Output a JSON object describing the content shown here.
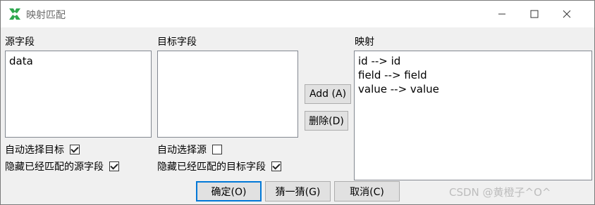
{
  "window": {
    "title": "映射匹配",
    "icon": "app-icon",
    "controls": {
      "minimize": "—",
      "maximize": "☐",
      "close": "✕"
    }
  },
  "source": {
    "label": "源字段",
    "items": [
      "data"
    ],
    "auto_select_label": "自动选择目标",
    "auto_select_checked": true,
    "hide_matched_label": "隐藏已经匹配的源字段",
    "hide_matched_checked": true
  },
  "target": {
    "label": "目标字段",
    "items": [],
    "auto_select_label": "自动选择源",
    "auto_select_checked": false,
    "hide_matched_label": "隐藏已经匹配的目标字段",
    "hide_matched_checked": true
  },
  "actions": {
    "add_label": "Add (A)",
    "delete_label": "删除(D)"
  },
  "mapping": {
    "label": "映射",
    "items": [
      "id --> id",
      "field --> field",
      "value --> value"
    ]
  },
  "footer": {
    "ok_label": "确定(O)",
    "guess_label": "猜一猜(G)",
    "cancel_label": "取消(C)"
  },
  "watermark": "CSDN @黄橙子^O^"
}
